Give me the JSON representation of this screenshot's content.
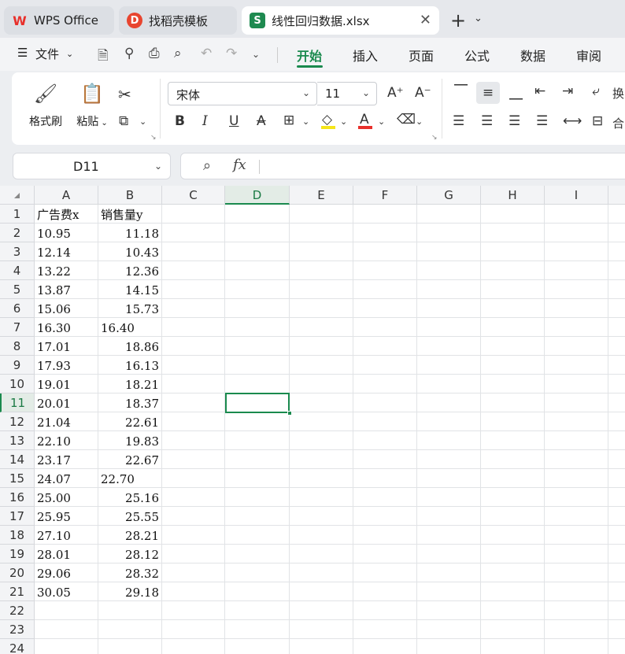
{
  "tabs": [
    {
      "label": "WPS Office",
      "icon": "W"
    },
    {
      "label": "找稻壳模板",
      "icon": "D"
    },
    {
      "label": "线性回归数据.xlsx",
      "icon": "S"
    }
  ],
  "menu": {
    "file_label": "文件",
    "ribbon_tabs": [
      "开始",
      "插入",
      "页面",
      "公式",
      "数据",
      "审阅"
    ]
  },
  "ribbon": {
    "format_painter": "格式刷",
    "paste": "粘贴",
    "font_name": "宋体",
    "font_size": "11",
    "wrap": "换",
    "merge": "合"
  },
  "formula_bar": {
    "cell_ref": "D11",
    "fx": "fx",
    "formula": ""
  },
  "sheet": {
    "columns": [
      "A",
      "B",
      "C",
      "D",
      "E",
      "F",
      "G",
      "H",
      "I"
    ],
    "active_column": "D",
    "rows": [
      "1",
      "2",
      "3",
      "4",
      "5",
      "6",
      "7",
      "8",
      "9",
      "10",
      "11",
      "12",
      "13",
      "14",
      "15",
      "16",
      "17",
      "18",
      "19",
      "20",
      "21",
      "22",
      "23",
      "24"
    ],
    "active_row": "11",
    "header_a": "广告费x",
    "header_b": "销售量y",
    "col_a": [
      "10.95",
      "12.14",
      "13.22",
      "13.87",
      "15.06",
      "16.30",
      "17.01",
      "17.93",
      "19.01",
      "20.01",
      "21.04",
      "22.10",
      "23.17",
      "24.07",
      "25.00",
      "25.95",
      "27.10",
      "28.01",
      "29.06",
      "30.05"
    ],
    "col_b": [
      "11.18",
      "10.43",
      "12.36",
      "14.15",
      "15.73",
      "16.40",
      "18.86",
      "16.13",
      "18.21",
      "18.37",
      "22.61",
      "19.83",
      "22.67",
      "22.70",
      "25.16",
      "25.55",
      "28.21",
      "28.12",
      "28.32",
      "29.18"
    ],
    "col_b_left_aligned_rows": [
      6,
      14
    ]
  },
  "colors": {
    "accent": "#1a8a4e",
    "wps_red": "#e8302b",
    "sheet_icon": "#1e8a50"
  }
}
